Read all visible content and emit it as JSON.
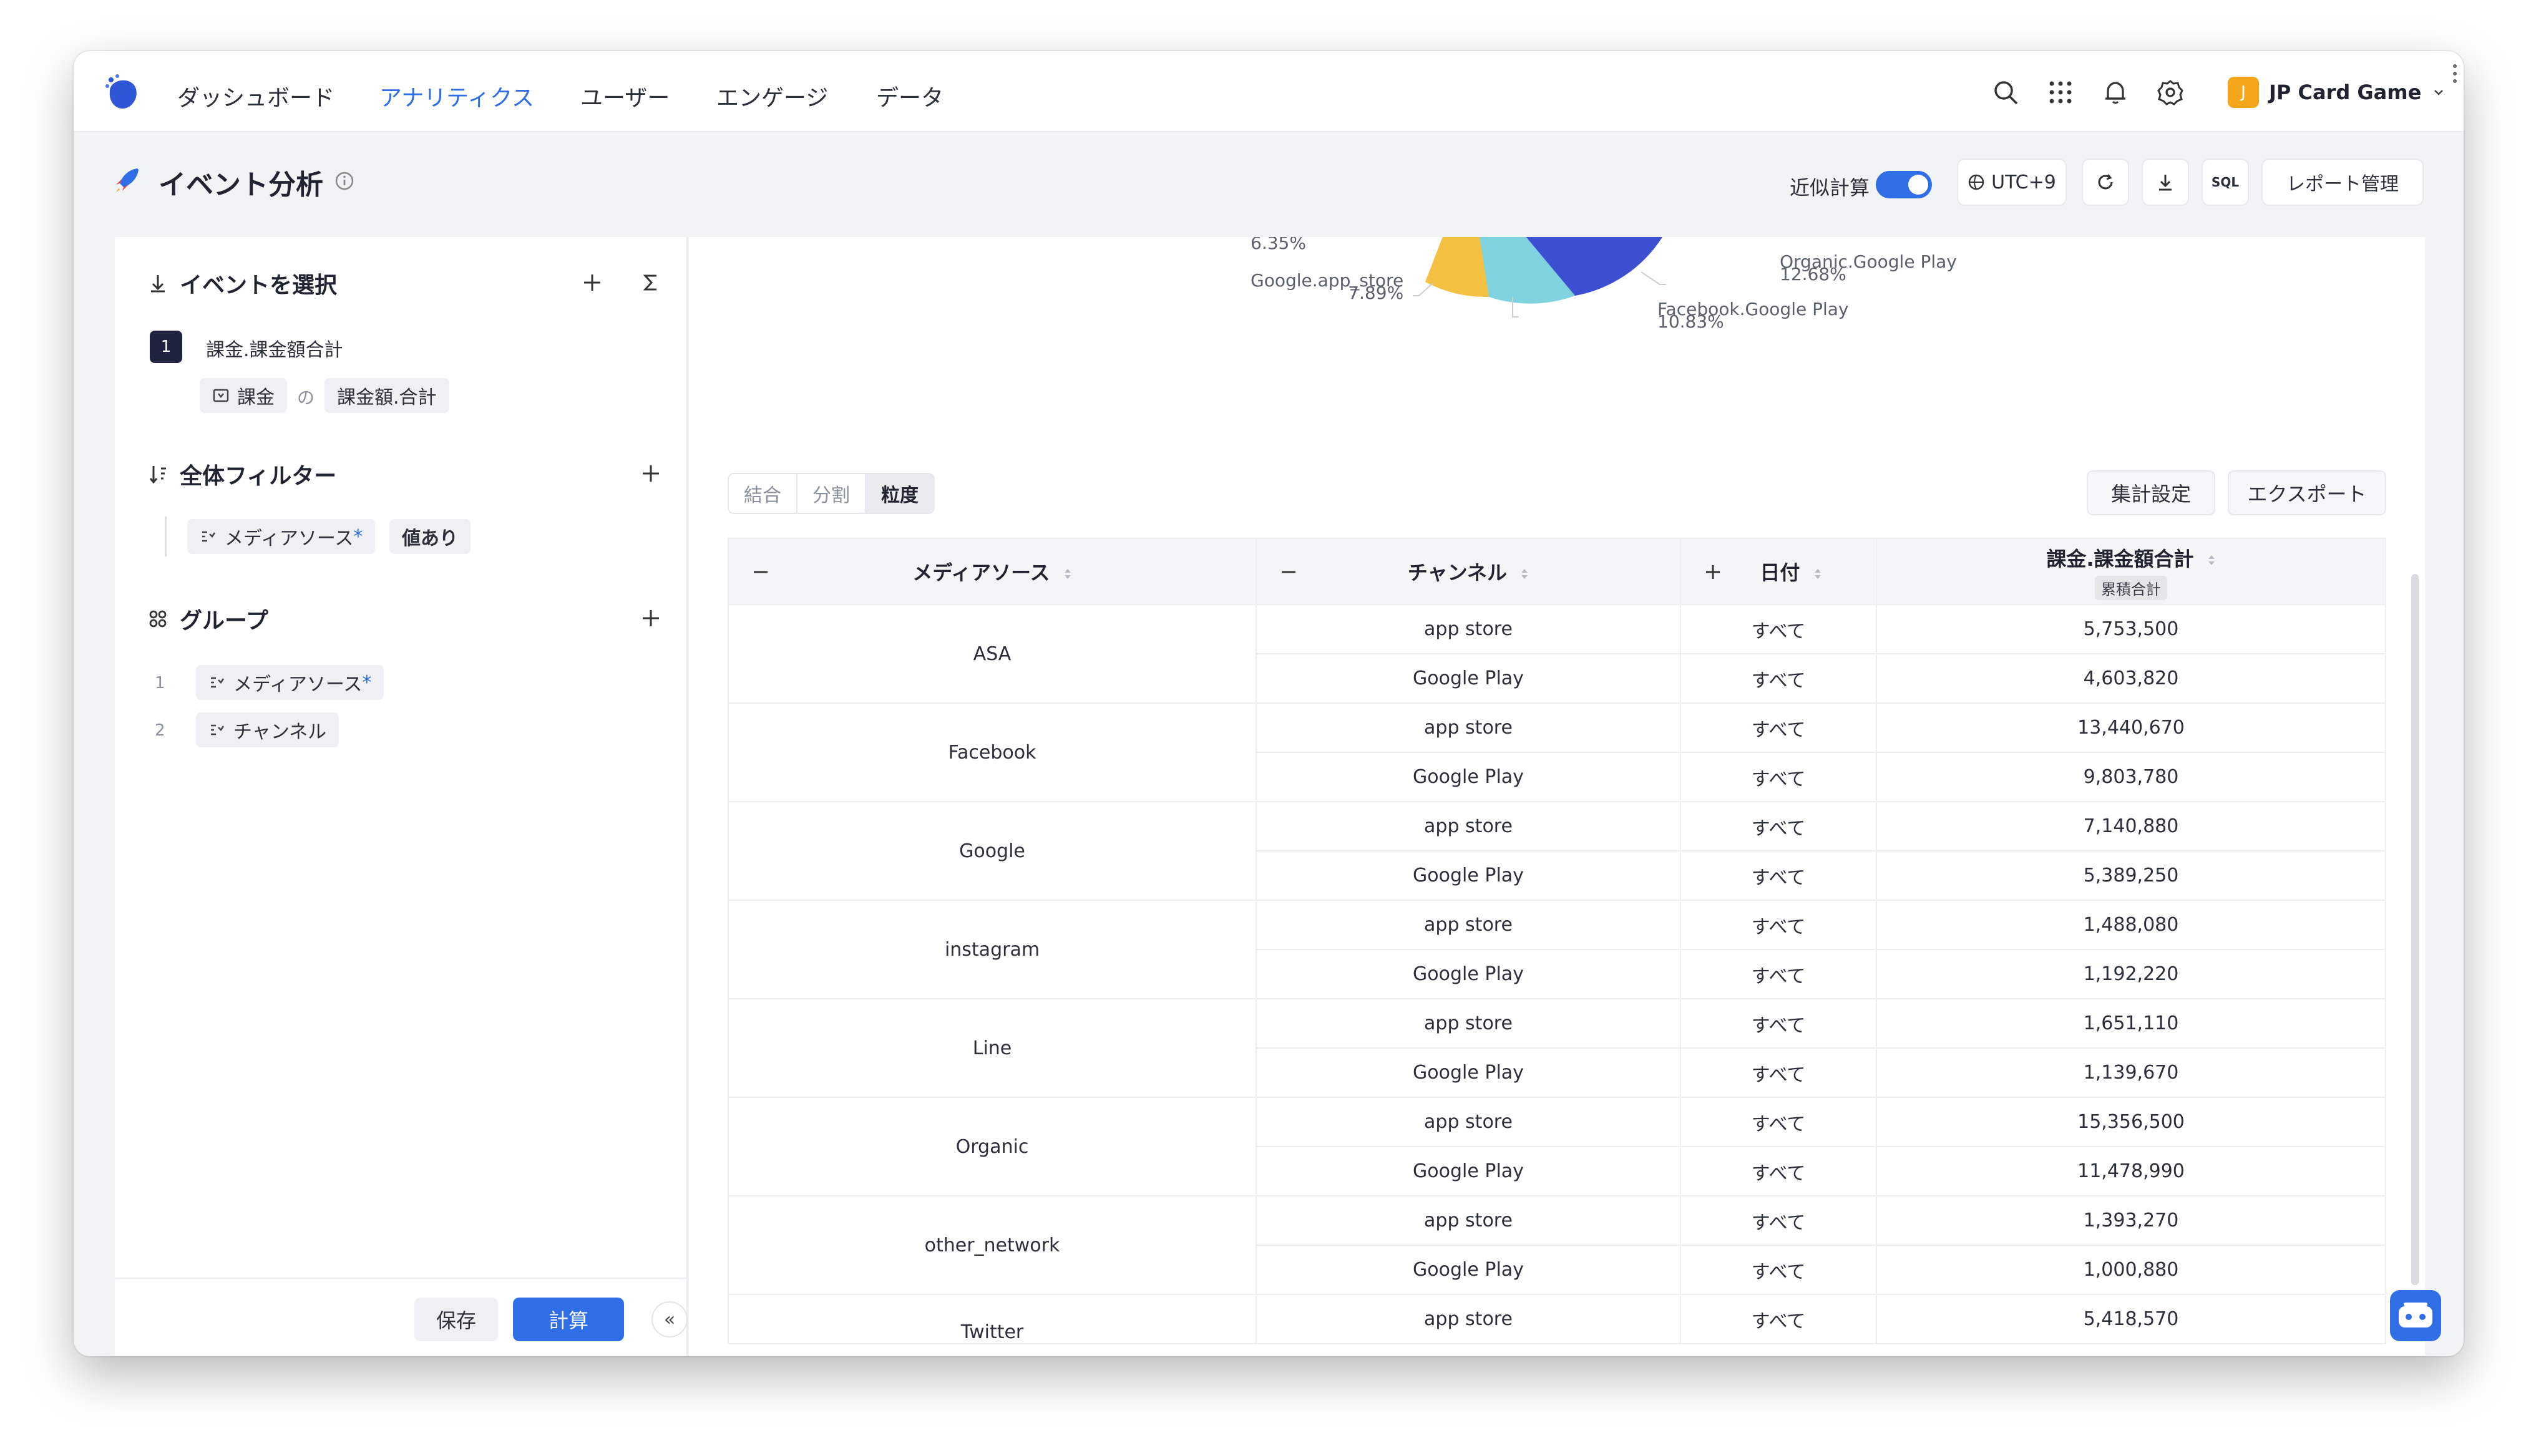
{
  "topnav": {
    "items": [
      "ダッシュボード",
      "アナリティクス",
      "ユーザー",
      "エンゲージ",
      "データ"
    ],
    "active_index": 1,
    "project": {
      "badge": "J",
      "name": "JP Card Game"
    }
  },
  "pagebar": {
    "title": "イベント分析",
    "approx_label": "近似計算",
    "approx_enabled": true,
    "timezone": "UTC+9",
    "sql_label": "SQL",
    "report_manage": "レポート管理"
  },
  "left": {
    "event_section": "イベントを選択",
    "event": {
      "index": "1",
      "name": "課金.課金額合計",
      "source": "課金",
      "connector": "の",
      "metric": "課金額.合計"
    },
    "filter_section": "全体フィルター",
    "filter": {
      "field": "メディアソース",
      "field_star": "*",
      "condition": "値あり"
    },
    "group_section": "グループ",
    "groups": [
      {
        "num": "1",
        "label": "メディアソース",
        "star": "*"
      },
      {
        "num": "2",
        "label": "チャンネル",
        "star": ""
      }
    ],
    "save": "保存",
    "calc": "計算",
    "collapse": "«"
  },
  "pie_labels": [
    {
      "name": "",
      "pct": "6.35%"
    },
    {
      "name": "Google.app_store",
      "pct": "7.89%"
    },
    {
      "name": "Facebook.Google Play",
      "pct": "10.83%"
    },
    {
      "name": "Organic.Google Play",
      "pct": "12.68%"
    }
  ],
  "colors": {
    "accent": "#2f6ee6",
    "pie_yellow": "#f4c042",
    "pie_teal": "#7fd3df",
    "pie_blue": "#3d4fd1"
  },
  "view_tabs": [
    "結合",
    "分割",
    "粒度"
  ],
  "view_active": 2,
  "actions": {
    "aggregate": "集計設定",
    "export": "エクスポート"
  },
  "table": {
    "columns": [
      "メディアソース",
      "チャンネル",
      "日付",
      "課金.課金額合計"
    ],
    "metric_sub": "累積合計",
    "groups": [
      {
        "source": "ASA",
        "rows": [
          {
            "channel": "app store",
            "date": "すべて",
            "value": "5,753,500"
          },
          {
            "channel": "Google Play",
            "date": "すべて",
            "value": "4,603,820"
          }
        ]
      },
      {
        "source": "Facebook",
        "rows": [
          {
            "channel": "app store",
            "date": "すべて",
            "value": "13,440,670"
          },
          {
            "channel": "Google Play",
            "date": "すべて",
            "value": "9,803,780"
          }
        ]
      },
      {
        "source": "Google",
        "rows": [
          {
            "channel": "app store",
            "date": "すべて",
            "value": "7,140,880"
          },
          {
            "channel": "Google Play",
            "date": "すべて",
            "value": "5,389,250"
          }
        ]
      },
      {
        "source": "instagram",
        "rows": [
          {
            "channel": "app store",
            "date": "すべて",
            "value": "1,488,080"
          },
          {
            "channel": "Google Play",
            "date": "すべて",
            "value": "1,192,220"
          }
        ]
      },
      {
        "source": "Line",
        "rows": [
          {
            "channel": "app store",
            "date": "すべて",
            "value": "1,651,110"
          },
          {
            "channel": "Google Play",
            "date": "すべて",
            "value": "1,139,670"
          }
        ]
      },
      {
        "source": "Organic",
        "rows": [
          {
            "channel": "app store",
            "date": "すべて",
            "value": "15,356,500"
          },
          {
            "channel": "Google Play",
            "date": "すべて",
            "value": "11,478,990"
          }
        ]
      },
      {
        "source": "other_network",
        "rows": [
          {
            "channel": "app store",
            "date": "すべて",
            "value": "1,393,270"
          },
          {
            "channel": "Google Play",
            "date": "すべて",
            "value": "1,000,880"
          }
        ]
      },
      {
        "source": "Twitter",
        "rows": [
          {
            "channel": "app store",
            "date": "すべて",
            "value": "5,418,570"
          }
        ]
      }
    ]
  }
}
